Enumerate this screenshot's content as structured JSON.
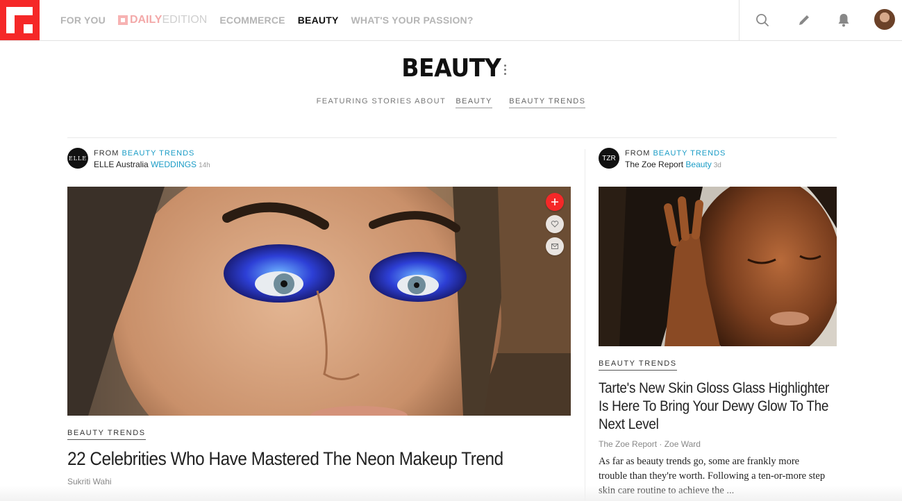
{
  "nav": {
    "items": [
      {
        "label": "FOR YOU",
        "active": false
      },
      {
        "label": "ECOMMERCE",
        "active": false
      },
      {
        "label": "BEAUTY",
        "active": true
      },
      {
        "label": "WHAT'S YOUR PASSION?",
        "active": false
      }
    ],
    "daily_edition": {
      "part_a": "DAILY",
      "part_b": "EDITION"
    },
    "icons": [
      "search-icon",
      "pencil-icon",
      "bell-icon"
    ]
  },
  "header": {
    "title": "BEAUTY",
    "featuring_label": "FEATURING STORIES ABOUT",
    "topics": [
      "BEAUTY",
      "BEAUTY TRENDS"
    ]
  },
  "main_article": {
    "from_label": "FROM",
    "magazine": "BEAUTY TRENDS",
    "source_logo": "ELLE",
    "source": "ELLE Australia",
    "section": "WEDDINGS",
    "age": "14h",
    "category": "BEAUTY TRENDS",
    "title": "22 Celebrities Who Have Mastered The Neon Makeup Trend",
    "author": "Sukriti Wahi"
  },
  "side_article": {
    "from_label": "FROM",
    "magazine": "BEAUTY TRENDS",
    "source_logo": "TZR",
    "source": "The Zoe Report",
    "section": "Beauty",
    "age": "3d",
    "category": "BEAUTY TRENDS",
    "title": "Tarte's New Skin Gloss Glass Highlighter Is Here To Bring Your Dewy Glow To The Next Level",
    "byline": "The Zoe Report · Zoe Ward",
    "excerpt": "As far as beauty trends go, some are frankly more trouble than they're worth. Following a ten-or-more step skin care routine to achieve the ..."
  },
  "colors": {
    "brand": "#f52828",
    "link": "#1a9cc6"
  }
}
